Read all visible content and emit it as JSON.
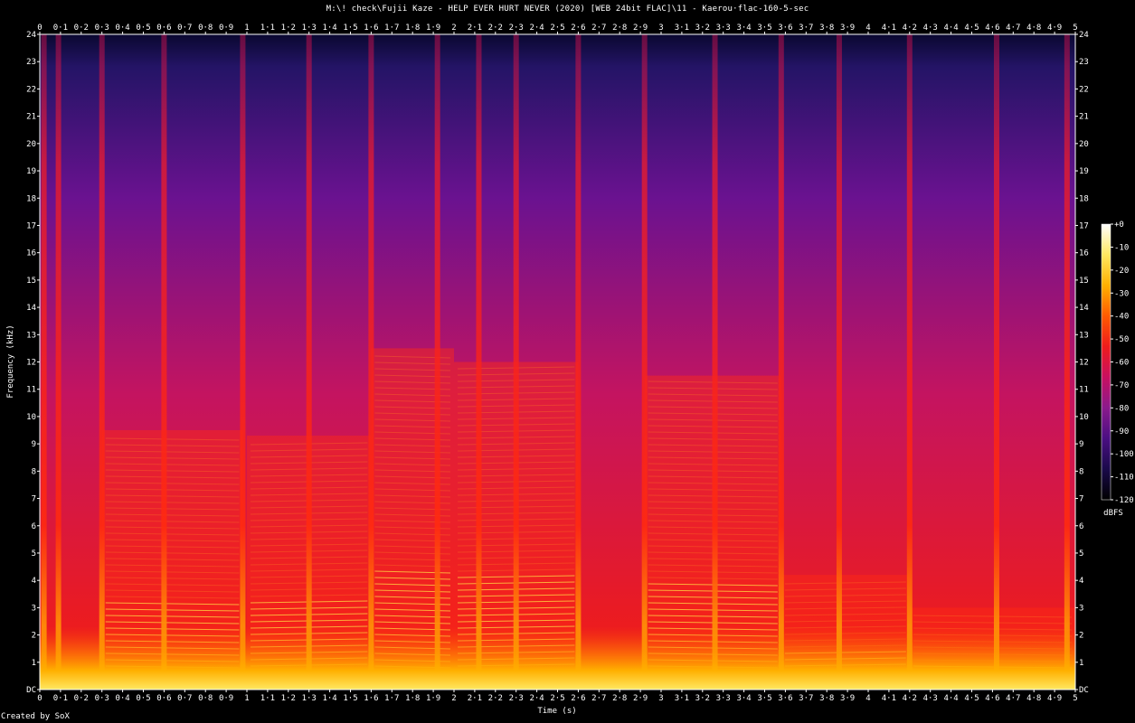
{
  "title": "M:\\! check\\Fujii Kaze - HELP EVER HURT NEVER (2020) [WEB 24bit FLAC]\\11 - Kaerou·flac-160-5-sec",
  "credit": "Created by SoX",
  "colors": {
    "background": "#000000",
    "frame": "#ffffff",
    "palette": [
      "#000000",
      "#1a0a4a",
      "#4a0f82",
      "#8a1a8c",
      "#c81060",
      "#ee1c1c",
      "#ff5a00",
      "#ffb000",
      "#ffe860",
      "#ffffff"
    ]
  },
  "chart_data": {
    "type": "heatmap",
    "title": "M:\\! check\\Fujii Kaze - HELP EVER HURT NEVER (2020) [WEB 24bit FLAC]\\11 - Kaerou·flac-160-5-sec",
    "xlabel": "Time (s)",
    "ylabel": "Frequency (kHz)",
    "xlim": [
      0,
      5
    ],
    "ylim": [
      0,
      24
    ],
    "x_ticks": [
      "0",
      "0·1",
      "0·2",
      "0·3",
      "0·4",
      "0·5",
      "0·6",
      "0·7",
      "0·8",
      "0·9",
      "1",
      "1·1",
      "1·2",
      "1·3",
      "1·4",
      "1·5",
      "1·6",
      "1·7",
      "1·8",
      "1·9",
      "2",
      "2·1",
      "2·2",
      "2·3",
      "2·4",
      "2·5",
      "2·6",
      "2·7",
      "2·8",
      "2·9",
      "3",
      "3·1",
      "3·2",
      "3·3",
      "3·4",
      "3·5",
      "3·6",
      "3·7",
      "3·8",
      "3·9",
      "4",
      "4·1",
      "4·2",
      "4·3",
      "4·4",
      "4·5",
      "4·6",
      "4·7",
      "4·8",
      "4·9",
      "5"
    ],
    "y_ticks": [
      "DC",
      "1",
      "2",
      "3",
      "4",
      "5",
      "6",
      "7",
      "8",
      "9",
      "10",
      "11",
      "12",
      "13",
      "14",
      "15",
      "16",
      "17",
      "18",
      "19",
      "20",
      "21",
      "22",
      "23",
      "24"
    ],
    "colorbar": {
      "label": "dBFS",
      "range": [
        -120,
        0
      ],
      "ticks": [
        "+0",
        "-10",
        "-20",
        "-30",
        "-40",
        "-50",
        "-60",
        "-70",
        "-80",
        "-90",
        "-100",
        "-110",
        "-120"
      ]
    },
    "onsets_s": [
      0.02,
      0.09,
      0.3,
      0.6,
      0.98,
      1.3,
      1.6,
      1.92,
      2.12,
      2.3,
      2.6,
      2.92,
      3.26,
      3.58,
      3.86,
      4.2,
      4.62,
      4.96
    ],
    "harmonic_regions": [
      {
        "start_s": 0.3,
        "end_s": 0.98,
        "top_khz": 9.5
      },
      {
        "start_s": 1.0,
        "end_s": 1.6,
        "top_khz": 9.3
      },
      {
        "start_s": 1.6,
        "end_s": 2.0,
        "top_khz": 12.5
      },
      {
        "start_s": 2.0,
        "end_s": 2.6,
        "top_khz": 12.0
      },
      {
        "start_s": 2.92,
        "end_s": 3.58,
        "top_khz": 11.5
      },
      {
        "start_s": 3.58,
        "end_s": 4.2,
        "top_khz": 4.2
      },
      {
        "start_s": 4.2,
        "end_s": 5.0,
        "top_khz": 3.0
      }
    ]
  }
}
